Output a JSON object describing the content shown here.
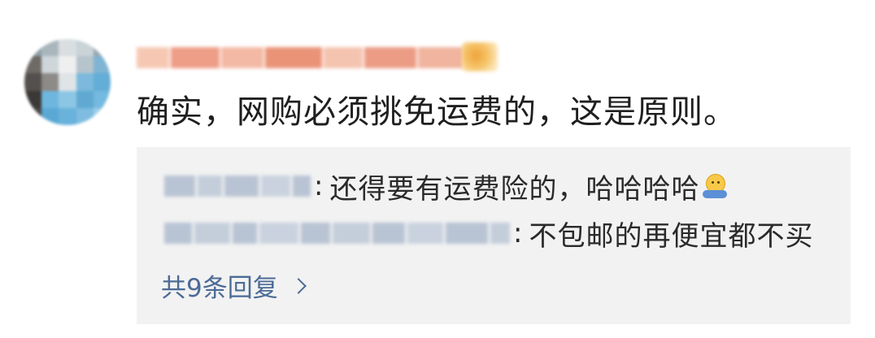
{
  "comment": {
    "text": "确实，网购必须挑免运费的，这是原则。"
  },
  "replies": [
    {
      "colon": ":",
      "text": "还得要有运费险的，哈哈哈哈",
      "emoji": "shrug-emoji"
    },
    {
      "colon": ":",
      "text": "不包邮的再便宜都不买"
    }
  ],
  "more_replies": {
    "label": "共9条回复",
    "icon": "chevron-right-icon"
  },
  "colors": {
    "background": "#ffffff",
    "reply_box": "#f2f2f2",
    "link": "#4b6b96",
    "text": "#1f1f1f"
  }
}
